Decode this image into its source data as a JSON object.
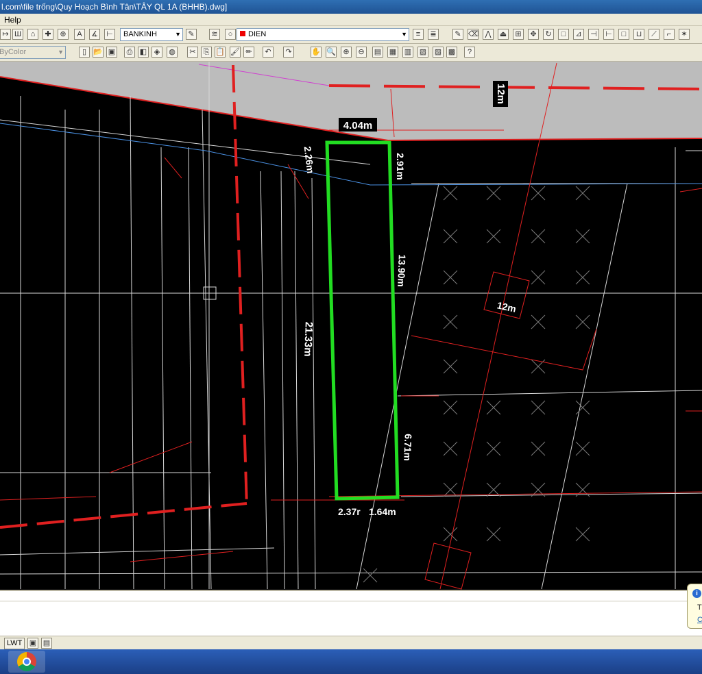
{
  "window": {
    "title": "l.com\\file trống\\Quy Hoạch Bình Tân\\TÂY QL 1A (BHHB).dwg]"
  },
  "menu": {
    "items": [
      "Help"
    ]
  },
  "toolbar": {
    "dimstyle_value": "BANKINH",
    "layer_value": "DIEN",
    "color_value": "ByColor"
  },
  "drawing": {
    "dimensions": {
      "top_width": "4.04m",
      "left_front": "2.26m",
      "right_front": "2.91m",
      "right_middle": "13.90m",
      "left_total": "21.33m",
      "right_rear": "6.71m",
      "bottom_left": "2.37r",
      "bottom_right": "1.64m",
      "road_top": "12m",
      "road_right": "12m"
    },
    "colors": {
      "background": "#000000",
      "road_area": "#bcbcbc",
      "lot_outline": "#22dd22",
      "boundary_red": "#e02020",
      "water_line": "#4a90e2"
    }
  },
  "statusbar": {
    "lwt_label": "LWT"
  },
  "popup": {
    "visible_text_1": "T",
    "visible_text_2": "C"
  }
}
